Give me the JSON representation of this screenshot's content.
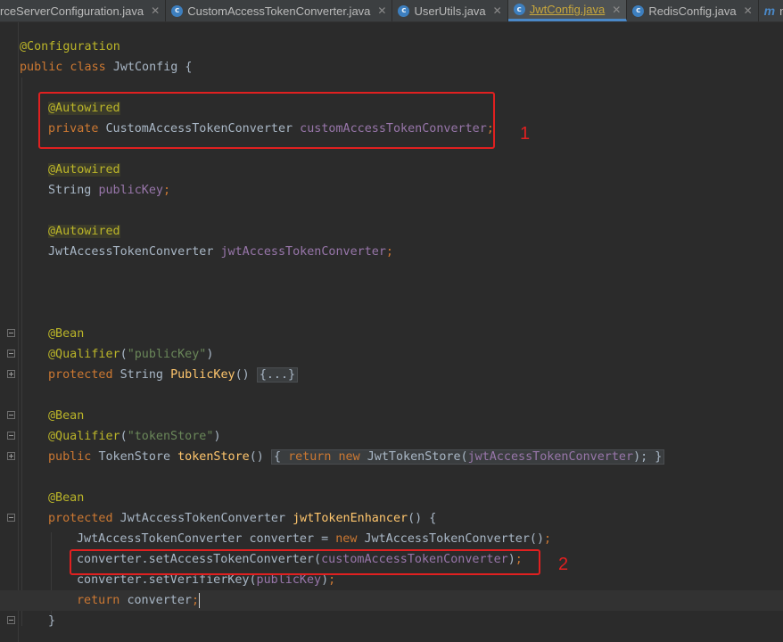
{
  "tabs": [
    {
      "label": "rceServerConfiguration.java",
      "icon": "class-icon",
      "active": false
    },
    {
      "label": "CustomAccessTokenConverter.java",
      "icon": "class-icon",
      "active": false
    },
    {
      "label": "UserUtils.java",
      "icon": "class-icon",
      "active": false
    },
    {
      "label": "JwtConfig.java",
      "icon": "class-icon",
      "active": true
    },
    {
      "label": "RedisConfig.java",
      "icon": "class-icon",
      "active": false
    },
    {
      "label": "no",
      "icon": "m-icon",
      "active": false
    }
  ],
  "code": {
    "l1": {
      "ann": "@Configuration"
    },
    "l2": {
      "kw": "public class ",
      "name": "JwtConfig {"
    },
    "l4": {
      "ann": "@Autowired"
    },
    "l5": {
      "kw": "private ",
      "type": "CustomAccessTokenConverter ",
      "field": "customAccessTokenConverter",
      "end": ";"
    },
    "l7": {
      "ann": "@Autowired"
    },
    "l8": {
      "type": "String ",
      "field": "publicKey",
      "end": ";"
    },
    "l10": {
      "ann": "@Autowired"
    },
    "l11": {
      "type": "JwtAccessTokenConverter ",
      "field": "jwtAccessTokenConverter",
      "end": ";"
    },
    "l16": {
      "ann": "@Bean"
    },
    "l17": {
      "ann": "@Qualifier",
      "open": "(",
      "str": "\"publicKey\"",
      "close": ")"
    },
    "l18": {
      "kw": "protected ",
      "type": "String ",
      "fn": "PublicKey",
      "paren": "() ",
      "fold": "{...}"
    },
    "l20": {
      "ann": "@Bean"
    },
    "l21": {
      "ann": "@Qualifier",
      "open": "(",
      "str": "\"tokenStore\"",
      "close": ")"
    },
    "l22": {
      "kw": "public ",
      "type": "TokenStore ",
      "fn": "tokenStore",
      "paren": "() ",
      "fold_open": "{ ",
      "ret": "return ",
      "new": "new ",
      "ctor": "JwtTokenStore(",
      "field": "jwtAccessTokenConverter",
      "close": ");",
      "fold_close": " }"
    },
    "l24": {
      "ann": "@Bean"
    },
    "l25": {
      "kw": "protected ",
      "type": "JwtAccessTokenConverter ",
      "fn": "jwtTokenEnhancer",
      "rest": "() {"
    },
    "l26": {
      "a": "JwtAccessTokenConverter converter = ",
      "kw": "new ",
      "b": "JwtAccessTokenConverter()",
      "end": ";"
    },
    "l27": {
      "a": "converter.setAccessTokenConverter(",
      "field": "customAccessTokenConverter",
      "b": ")",
      "end": ";"
    },
    "l28": {
      "a": "converter.setVerifierKey(",
      "field": "publicKey",
      "b": ")",
      "end": ";"
    },
    "l29": {
      "kw": "return ",
      "a": "converter",
      "end": ";"
    },
    "l30": {
      "a": "}"
    }
  },
  "markers": {
    "one": "1",
    "two": "2"
  },
  "colors": {
    "background": "#2b2b2b",
    "annotation": "#bbb529",
    "keyword": "#cc7832",
    "field": "#9876aa",
    "string": "#6a8759",
    "method": "#ffc66d",
    "highlight_box": "#e02020"
  }
}
